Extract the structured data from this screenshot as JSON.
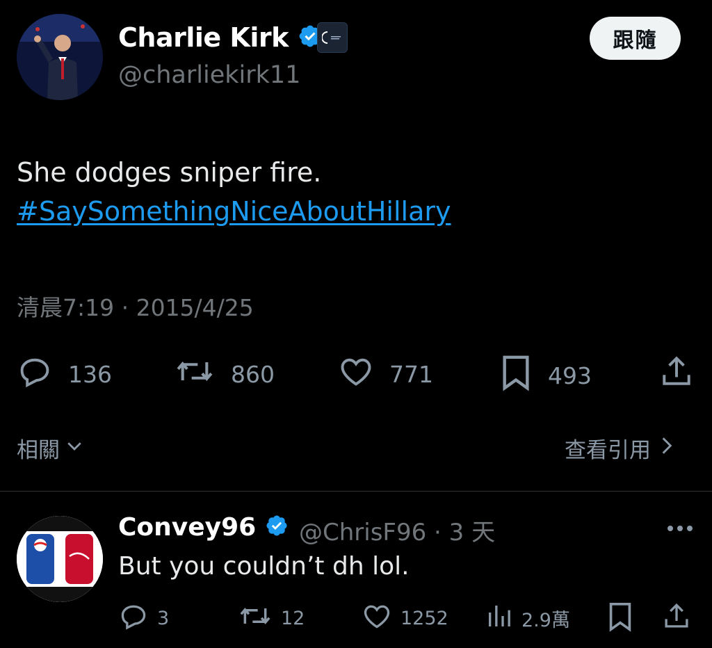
{
  "tweet": {
    "author_name": "Charlie Kirk",
    "author_handle": "@charliekirk11",
    "follow_label": "跟隨",
    "text": "She dodges sniper fire.",
    "hashtag": "#SaySomethingNiceAboutHillary",
    "timestamp": "清晨7:19 · 2015/4/25",
    "stats": {
      "replies": "136",
      "retweets": "860",
      "likes": "771",
      "bookmarks": "493"
    },
    "related_label": "相關",
    "view_quotes_label": "查看引用"
  },
  "reply": {
    "author_name": "Convey96",
    "author_handle": "@ChrisF96 · 3 天",
    "text": "But you couldn’t dh lol.",
    "stats": {
      "replies": "3",
      "retweets": "12",
      "likes": "1252",
      "views": "2.9萬"
    }
  },
  "colors": {
    "background": "#000000",
    "accent": "#1d9bf0",
    "secondary_text": "#71767b",
    "verified": "#1d9bf0"
  },
  "icons": [
    "verified-badge-icon",
    "reply-icon",
    "retweet-icon",
    "like-icon",
    "bookmark-icon",
    "share-icon",
    "views-icon",
    "more-icon",
    "chevron-down-icon",
    "chevron-right-icon"
  ]
}
